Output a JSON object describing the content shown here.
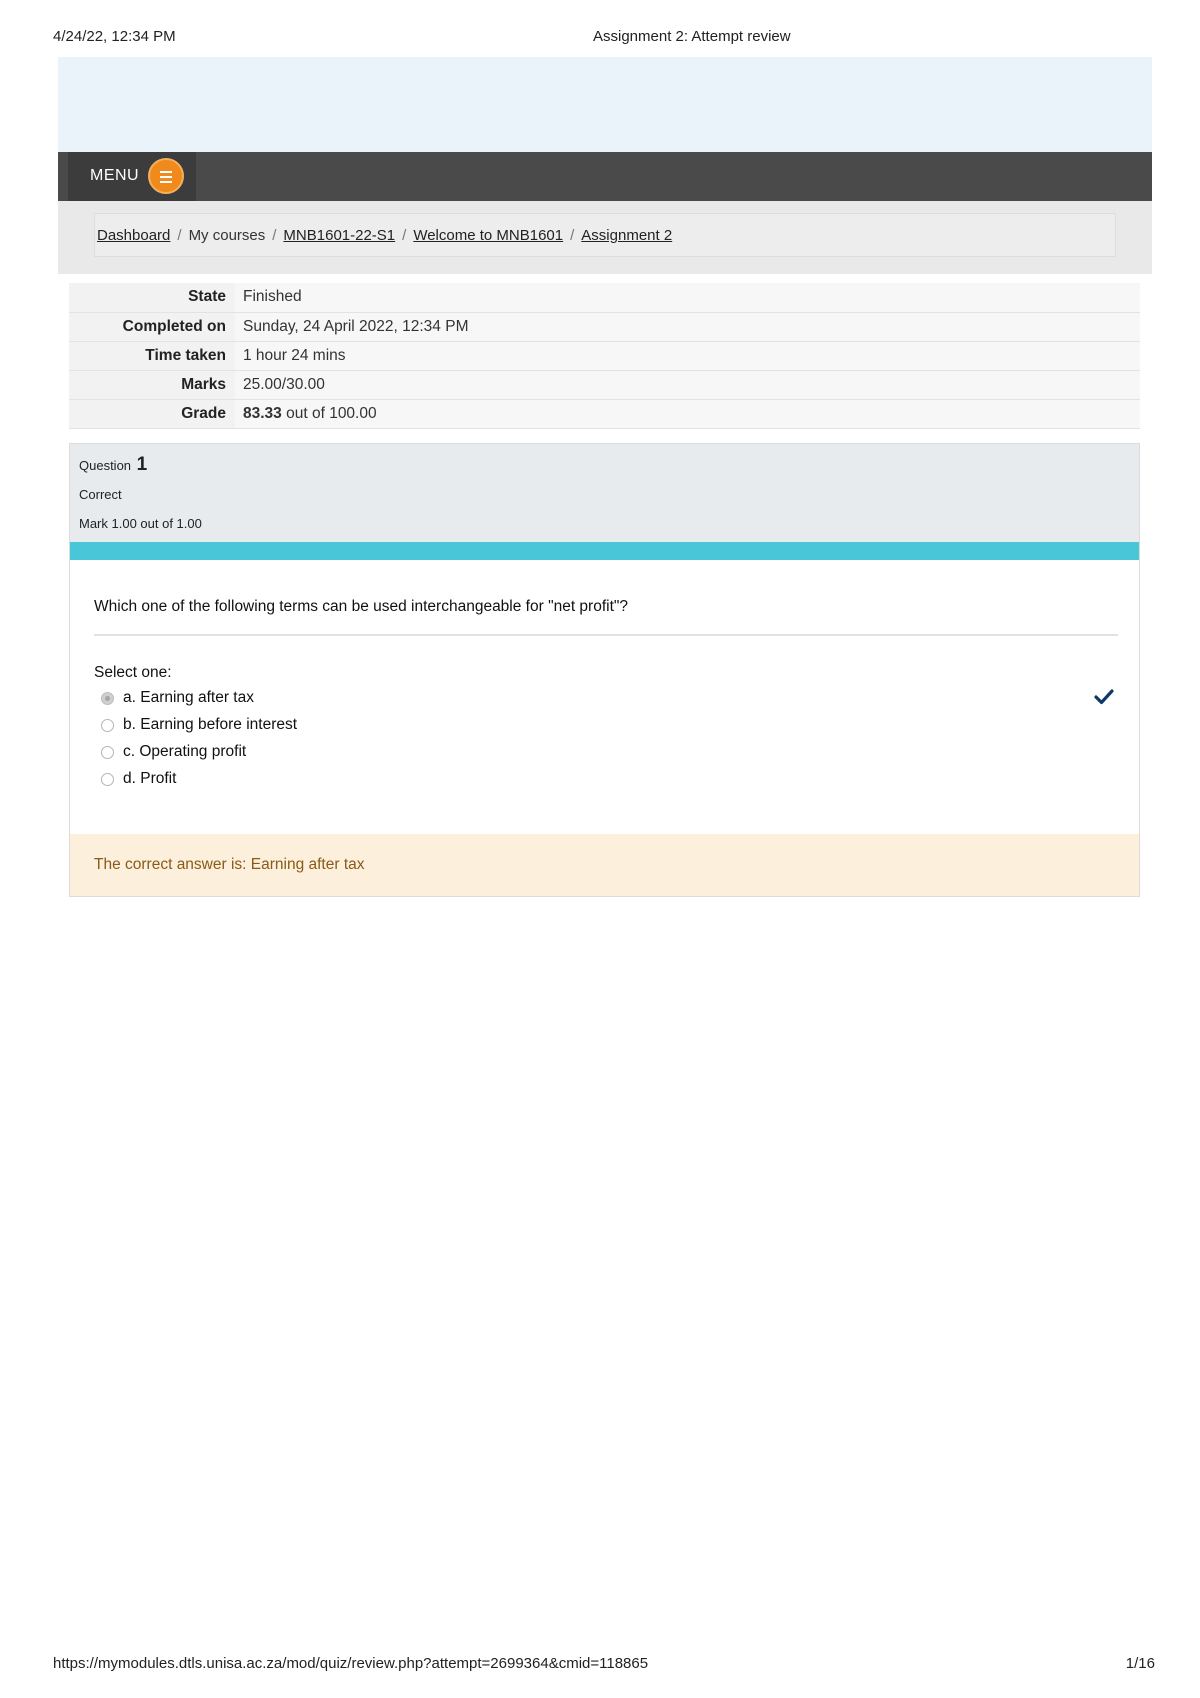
{
  "print": {
    "datetime": "4/24/22, 12:34 PM",
    "page_title": "Assignment 2: Attempt review",
    "url": "https://mymodules.dtls.unisa.ac.za/mod/quiz/review.php?attempt=2699364&cmid=118865",
    "page_number": "1/16"
  },
  "navbar": {
    "menu_label": "MENU",
    "menu_icon": "hamburger-icon",
    "accent_color": "#f08a1c"
  },
  "breadcrumb": [
    "Dashboard",
    "My courses",
    "MNB1601-22-S1",
    "Welcome to MNB1601",
    "Assignment 2"
  ],
  "summary": {
    "rows": [
      {
        "label": "State",
        "value": "Finished"
      },
      {
        "label": "Completed on",
        "value": "Sunday, 24 April 2022, 12:34 PM"
      },
      {
        "label": "Time taken",
        "value": "1 hour 24 mins"
      },
      {
        "label": "Marks",
        "value": "25.00/30.00"
      }
    ],
    "grade": {
      "label": "Grade",
      "score": "83.33",
      "rest": "out of 100.00"
    }
  },
  "question": {
    "title": "Question",
    "number": "1",
    "state": "Correct",
    "grade": "Mark 1.00 out of 1.00",
    "text": "Which one of the following terms can be used interchangeable for \"net profit\"?",
    "prompt": "Select one:",
    "answers": [
      {
        "label": "a. Earning after tax",
        "selected": true
      },
      {
        "label": "b. Earning before interest",
        "selected": false
      },
      {
        "label": "c. Operating profit",
        "selected": false
      },
      {
        "label": "d. Profit",
        "selected": false
      }
    ],
    "result_icon": "checkmark-icon",
    "feedback": "The correct answer is: Earning after tax",
    "colors": {
      "accent": "#49c7d8",
      "feedback_bg": "#fcefdc",
      "feedback_text": "#8a5a16",
      "check": "#0f3a66"
    }
  }
}
